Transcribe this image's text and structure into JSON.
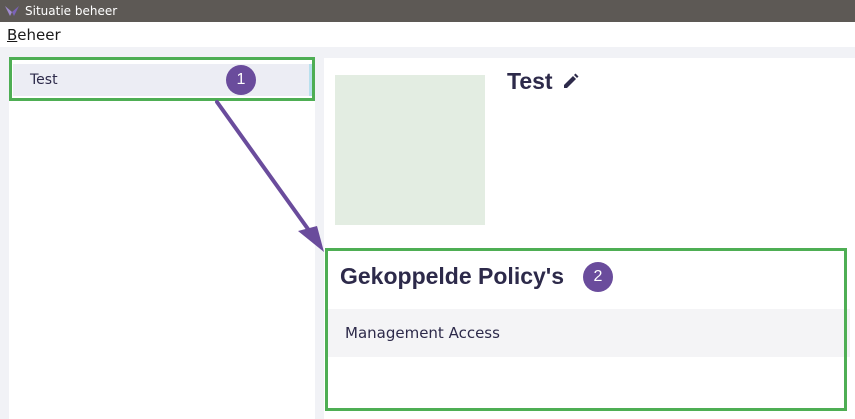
{
  "window": {
    "title": "Situatie beheer",
    "icon": "app-logo-icon"
  },
  "menubar": {
    "items": [
      {
        "label": "Beheer",
        "underline": "B",
        "rest": "eheer"
      }
    ]
  },
  "sidebar": {
    "items": [
      {
        "label": "Test",
        "selected": true
      }
    ]
  },
  "detail": {
    "name": "Test",
    "edit_icon": "pencil-icon"
  },
  "policies": {
    "heading": "Gekoppelde Policy's",
    "items": [
      {
        "label": "Management Access"
      }
    ]
  },
  "callouts": [
    {
      "number": "1"
    },
    {
      "number": "2"
    }
  ],
  "colors": {
    "titlebar": "#5d5955",
    "accent_purple": "#6a4c9c",
    "callout_green": "#4eae54",
    "text_dark": "#2d2a4a"
  }
}
